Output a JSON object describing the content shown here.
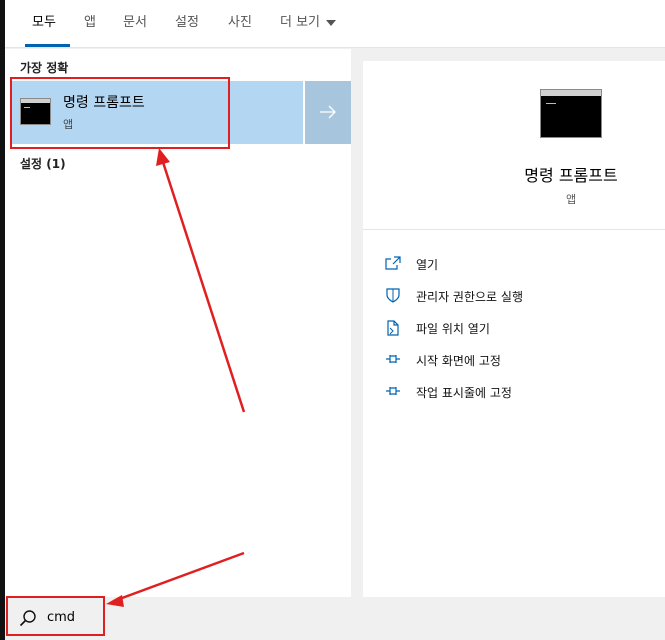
{
  "tabs": [
    {
      "label": "모두",
      "active": true
    },
    {
      "label": "앱"
    },
    {
      "label": "문서"
    },
    {
      "label": "설정"
    },
    {
      "label": "사진"
    },
    {
      "label": "더 보기"
    }
  ],
  "results": {
    "best_match_label": "가장 정확",
    "best_match": {
      "name": "명령 프롬프트",
      "type": "앱",
      "icon": "command-prompt-icon"
    },
    "settings_label": "설정 (1)"
  },
  "details": {
    "name": "명령 프롬프트",
    "type": "앱",
    "actions": [
      {
        "label": "열기",
        "icon": "open-icon"
      },
      {
        "label": "관리자 권한으로 실행",
        "icon": "shield-icon"
      },
      {
        "label": "파일 위치 열기",
        "icon": "file-location-icon"
      },
      {
        "label": "시작 화면에 고정",
        "icon": "pin-icon"
      },
      {
        "label": "작업 표시줄에 고정",
        "icon": "pin-icon"
      }
    ]
  },
  "search": {
    "query": "cmd",
    "icon": "search-icon"
  },
  "annotation": {
    "color": "#e02020"
  },
  "colors": {
    "accent": "#0063b1",
    "selection": "#b3d7f3"
  }
}
